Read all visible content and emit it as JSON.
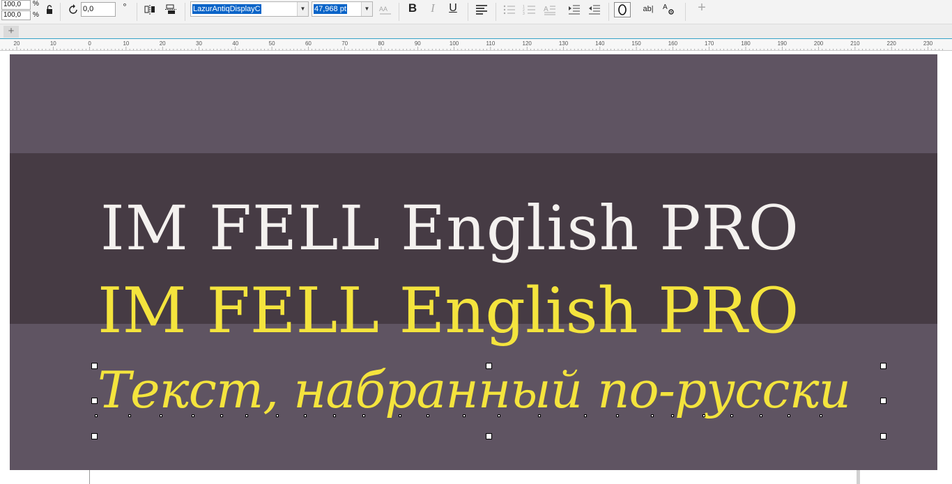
{
  "propbar": {
    "scale_x": "100,0",
    "scale_y": "100,0",
    "percent_sign": "%",
    "rotation": "0,0",
    "degree_sign": "°",
    "font_name": "LazurAntiqDisplayC",
    "font_size": "47,968 pt",
    "bold": "B",
    "italic": "I",
    "underline": "U",
    "text_props_label": "ab|",
    "char_format_label": "A",
    "add_label": "+"
  },
  "tabstrip": {
    "add_tab_label": "+"
  },
  "ruler": {
    "ticks": [
      "20",
      "10",
      "0",
      "10",
      "20",
      "30",
      "40",
      "50",
      "60",
      "70",
      "80",
      "90",
      "100",
      "110",
      "120",
      "130",
      "140",
      "150",
      "160",
      "170",
      "180",
      "190",
      "200",
      "210",
      "220",
      "230"
    ]
  },
  "artwork": {
    "line1": "IM FELL English PRO",
    "line2": "IM FELL English PRO",
    "line3": "Текст, набранный по-русски",
    "background": "#5f5462",
    "band": "#463b44",
    "white_text": "#f4f1ef",
    "yellow_text": "#f4e43d"
  }
}
